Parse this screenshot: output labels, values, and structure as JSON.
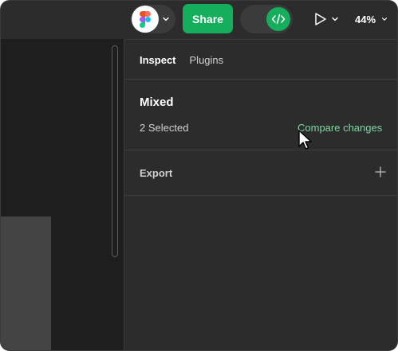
{
  "toolbar": {
    "app_logo_icon": "figma-logo-icon",
    "share_label": "Share",
    "dev_mode_icon": "code-brackets-icon",
    "present_icon": "play-icon",
    "zoom_level": "44%",
    "colors": {
      "share": "#14ae5c",
      "toolbar_bg": "#2c2c2c"
    }
  },
  "panel": {
    "tabs": [
      {
        "label": "Inspect",
        "active": true
      },
      {
        "label": "Plugins",
        "active": false
      }
    ],
    "selection": {
      "title": "Mixed",
      "count_label": "2 Selected",
      "compare_link": "Compare changes"
    },
    "export": {
      "label": "Export",
      "add_icon": "plus-icon"
    }
  },
  "colors": {
    "canvas_bg": "#1e1e1e",
    "panel_bg": "#2c2c2c",
    "link": "#7fd6a1"
  }
}
